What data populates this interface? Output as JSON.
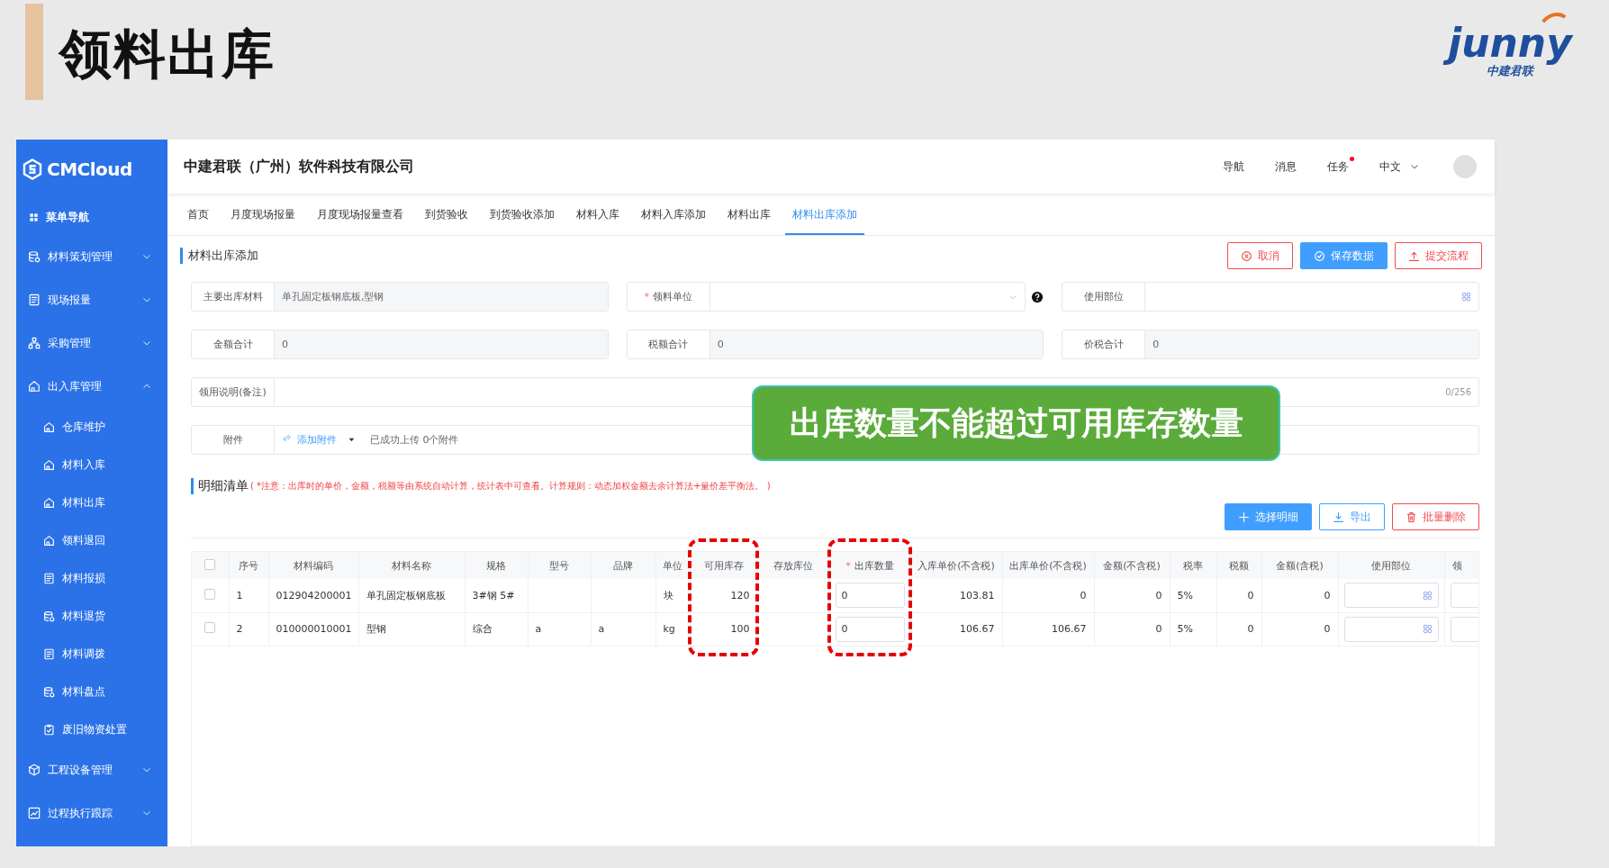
{
  "slide": {
    "title": "领料出库",
    "logo": {
      "wordmark": "junny",
      "tagline": "中建君联"
    }
  },
  "sidebar": {
    "logo": "CMCloud",
    "nav_label": "菜单导航",
    "groups": [
      {
        "label": "材料策划管理",
        "expanded": false
      },
      {
        "label": "现场报量",
        "expanded": false
      },
      {
        "label": "采购管理",
        "expanded": false
      },
      {
        "label": "出入库管理",
        "expanded": true,
        "children": [
          {
            "label": "仓库维护"
          },
          {
            "label": "材料入库"
          },
          {
            "label": "材料出库"
          },
          {
            "label": "领料退回"
          },
          {
            "label": "材料报损"
          },
          {
            "label": "材料退货"
          },
          {
            "label": "材料调拨"
          },
          {
            "label": "材料盘点"
          },
          {
            "label": "废旧物资处置"
          }
        ]
      },
      {
        "label": "工程设备管理",
        "expanded": false
      },
      {
        "label": "过程执行跟踪",
        "expanded": false
      }
    ]
  },
  "header": {
    "company": "中建君联（广州）软件科技有限公司",
    "links": [
      {
        "label": "导航",
        "alert": false
      },
      {
        "label": "消息",
        "alert": false
      },
      {
        "label": "任务",
        "alert": true
      }
    ],
    "language": "中文"
  },
  "tabs": [
    {
      "label": "首页",
      "selected": false
    },
    {
      "label": "月度现场报量",
      "selected": false
    },
    {
      "label": "月度现场报量查看",
      "selected": false
    },
    {
      "label": "到货验收",
      "selected": false
    },
    {
      "label": "到货验收添加",
      "selected": false
    },
    {
      "label": "材料入库",
      "selected": false
    },
    {
      "label": "材料入库添加",
      "selected": false
    },
    {
      "label": "材料出库",
      "selected": false
    },
    {
      "label": "材料出库添加",
      "selected": true
    }
  ],
  "page": {
    "title": "材料出库添加",
    "buttons": [
      {
        "label": "取消",
        "kind": "cancel"
      },
      {
        "label": "保存数据",
        "kind": "save"
      },
      {
        "label": "提交流程",
        "kind": "submit"
      }
    ]
  },
  "form": {
    "rows": [
      [
        {
          "label": "主要出库材料",
          "kind": "readonly",
          "help": false,
          "value": "单孔固定板钢底板,型钢"
        },
        {
          "required_mark": "*",
          "label": "领料单位",
          "kind": "select",
          "help": true
        },
        {
          "label": "使用部位",
          "kind": "picker",
          "help": false
        }
      ],
      [
        {
          "label": "金额合计",
          "kind": "readonly",
          "help": false,
          "value": "0"
        },
        {
          "label": "税额合计",
          "kind": "readonly",
          "help": false,
          "value": "0"
        },
        {
          "label": "价税合计",
          "kind": "readonly",
          "help": false,
          "value": "0"
        }
      ],
      [
        {
          "label": "领用说明(备注)",
          "kind": "textarea",
          "help": false,
          "counter": "0/256"
        }
      ],
      [
        {
          "label": "附件",
          "kind": "upload",
          "help": false,
          "link": "添加附件",
          "status": "已成功上传 0个附件"
        }
      ]
    ]
  },
  "callout": {
    "text": "出库数量不能超过可用库存数量"
  },
  "detail": {
    "title": "明细清单",
    "note": "( *注意：出库时的单价，金额，税额等由系统自动计算，统计表中可查看。计算规则：动态加权金额去余计算法+量价差平衡法。 )",
    "buttons": [
      {
        "label": "选择明细",
        "kind": "add"
      },
      {
        "label": "导出",
        "kind": "export"
      },
      {
        "label": "批量删除",
        "kind": "delete"
      }
    ],
    "table": {
      "all_selected": false,
      "columns": [
        {
          "label": "序号",
          "kind": "text",
          "highlighted": false
        },
        {
          "label": "材料编码",
          "kind": "text",
          "highlighted": false
        },
        {
          "label": "材料名称",
          "kind": "text",
          "highlighted": false
        },
        {
          "label": "规格",
          "kind": "text",
          "highlighted": false
        },
        {
          "label": "型号",
          "kind": "text",
          "highlighted": false
        },
        {
          "label": "品牌",
          "kind": "text",
          "highlighted": false
        },
        {
          "label": "单位",
          "kind": "text",
          "highlighted": false
        },
        {
          "label": "可用库存",
          "kind": "text",
          "highlighted": true
        },
        {
          "label": "存放库位",
          "kind": "text",
          "highlighted": false
        },
        {
          "required_mark": "*",
          "label": "出库数量",
          "kind": "input",
          "highlighted": true
        },
        {
          "label": "入库单价(不含税)",
          "kind": "text",
          "highlighted": false
        },
        {
          "label": "出库单价(不含税)",
          "kind": "text",
          "highlighted": false
        },
        {
          "label": "金额(不含税)",
          "kind": "text",
          "highlighted": false
        },
        {
          "label": "税率",
          "kind": "text",
          "highlighted": false
        },
        {
          "label": "税额",
          "kind": "text",
          "highlighted": false
        },
        {
          "label": "金额(含税)",
          "kind": "text",
          "highlighted": false
        },
        {
          "label": "使用部位",
          "kind": "picker",
          "highlighted": false
        },
        {
          "label": "领",
          "kind": "blank-input",
          "highlighted": false
        }
      ],
      "rows": [
        {
          "selected": false,
          "cells": [
            "1",
            "012904200001",
            "单孔固定板钢底板",
            "3#钢 5#",
            null,
            null,
            "块",
            "120",
            null,
            "0",
            "103.81",
            "0",
            "0",
            "5%",
            "0",
            "0"
          ]
        },
        {
          "selected": false,
          "cells": [
            "2",
            "010000010001",
            "型钢",
            "综合",
            "a",
            "a",
            "kg",
            "100",
            null,
            "0",
            "106.67",
            "106.67",
            "0",
            "5%",
            "0",
            "0"
          ]
        }
      ]
    }
  }
}
